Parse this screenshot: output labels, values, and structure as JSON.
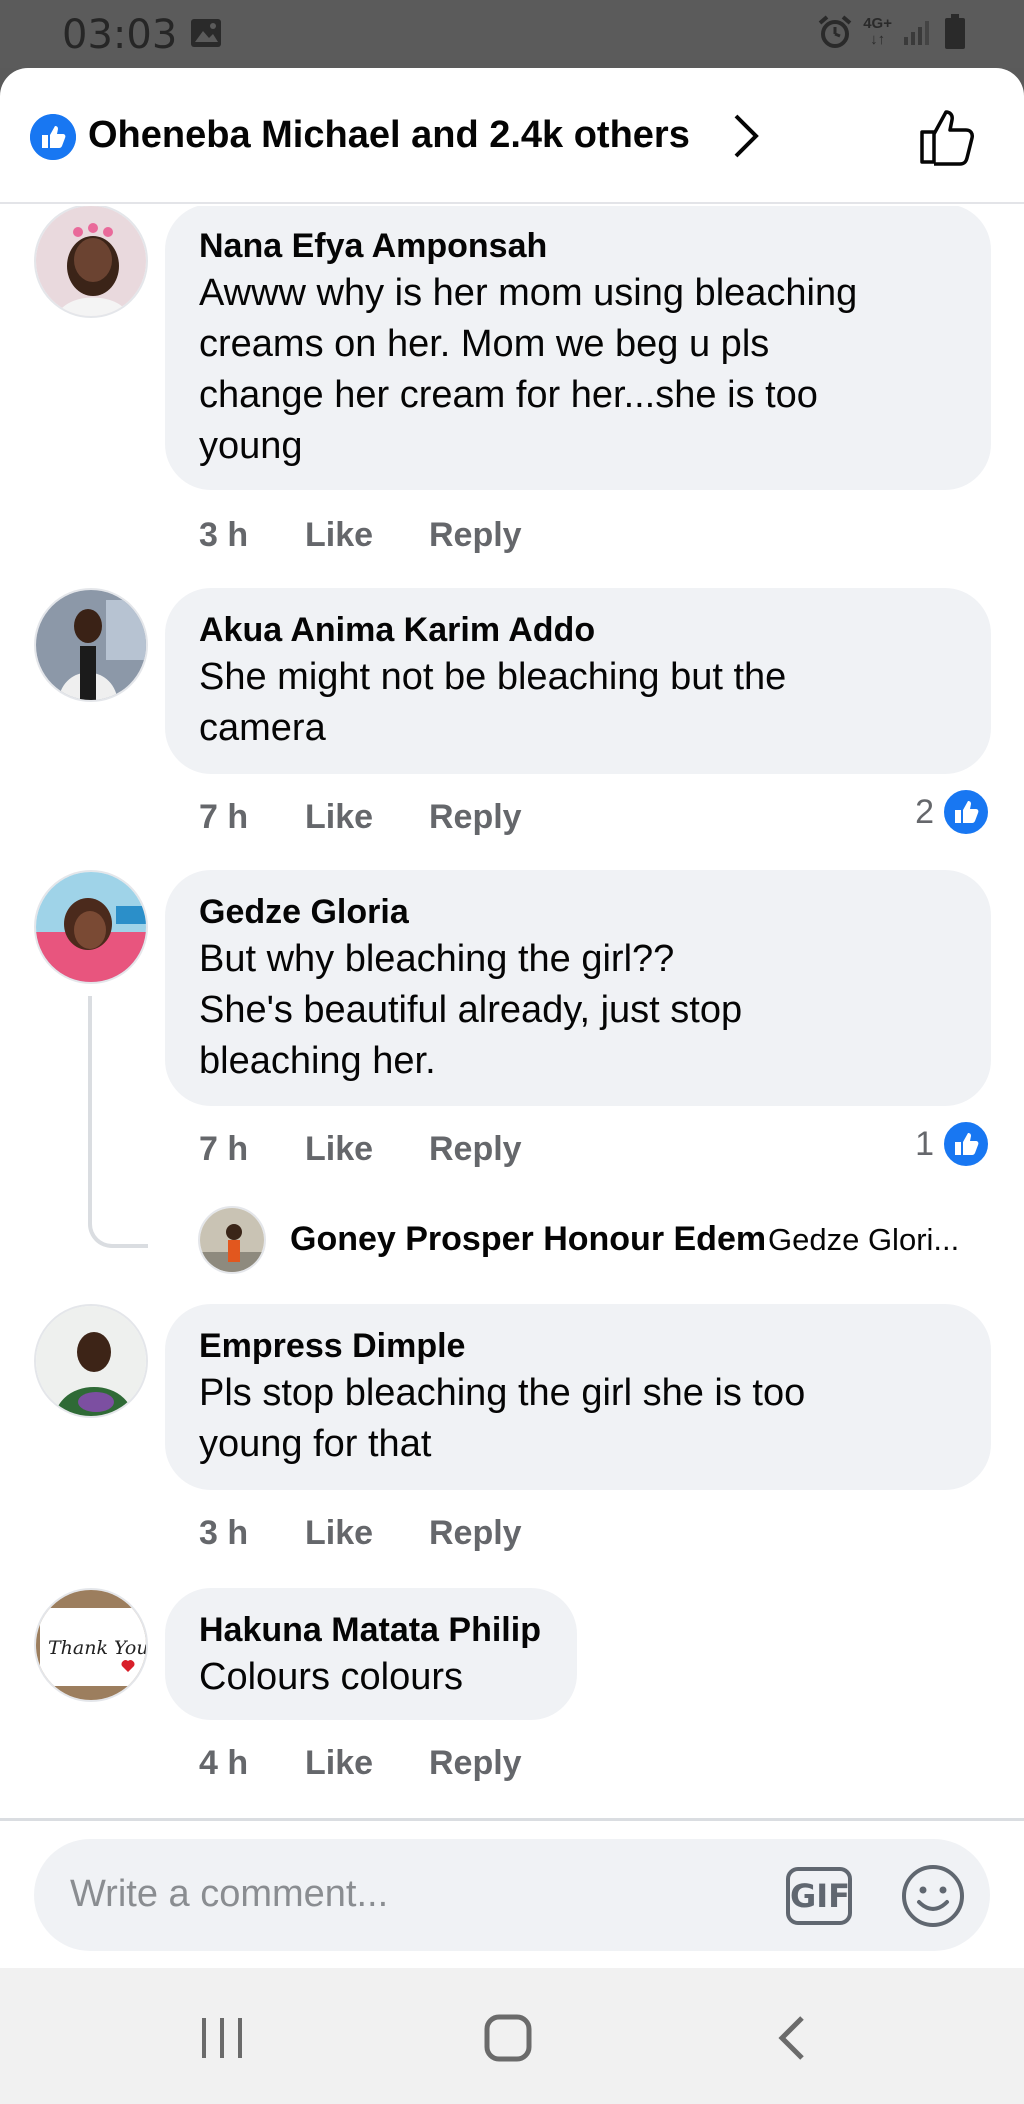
{
  "status_bar": {
    "time": "03:03",
    "network": "4G+"
  },
  "header": {
    "title": "Oheneba Michael and 2.4k others"
  },
  "comments": [
    {
      "author": "Nana Efya Amponsah",
      "text": "Awww why is her mom using bleaching\ncreams on her. Mom we beg u pls\nchange her cream for her...she is too\nyoung",
      "time": "3 h",
      "like_label": "Like",
      "reply_label": "Reply"
    },
    {
      "author": "Akua Anima Karim Addo",
      "text": "She might not be bleaching but the\ncamera",
      "time": "7 h",
      "like_label": "Like",
      "reply_label": "Reply",
      "reaction_count": "2"
    },
    {
      "author": "Gedze Gloria",
      "text": "But why bleaching the girl??\nShe's beautiful already, just stop\nbleaching her.",
      "time": "7 h",
      "like_label": "Like",
      "reply_label": "Reply",
      "reaction_count": "1",
      "reply_preview": {
        "author": "Goney Prosper Honour Edem",
        "snippet": "Gedze Glori..."
      }
    },
    {
      "author": "Empress Dimple",
      "text": "Pls stop bleaching the girl she is too\nyoung for that",
      "time": "3 h",
      "like_label": "Like",
      "reply_label": "Reply"
    },
    {
      "author": "Hakuna Matata Philip",
      "text": "Colours colours",
      "time": "4 h",
      "like_label": "Like",
      "reply_label": "Reply",
      "avatar_caption": "Thank You !"
    }
  ],
  "composer": {
    "placeholder": "Write a comment...",
    "gif_label": "GIF"
  },
  "colors": {
    "accent": "#1877f2",
    "bubble": "#f0f2f5",
    "muted": "#65676b"
  },
  "icons": [
    "image-icon",
    "alarm-icon",
    "signal-icon",
    "battery-icon",
    "like-icon",
    "chevron-right-icon",
    "thumbs-up-icon",
    "emoji-icon",
    "recents-icon",
    "home-icon",
    "back-icon"
  ]
}
